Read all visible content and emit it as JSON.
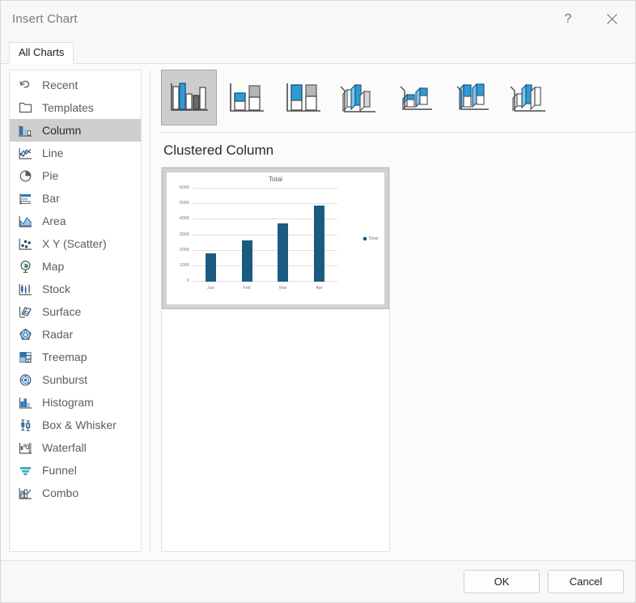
{
  "window": {
    "title": "Insert Chart",
    "help_icon": "question-mark-icon",
    "close_icon": "close-icon"
  },
  "tabs": [
    {
      "label": "All Charts",
      "selected": true
    }
  ],
  "sidebar": {
    "items": [
      {
        "label": "Recent",
        "icon": "recent-icon",
        "selected": false
      },
      {
        "label": "Templates",
        "icon": "templates-icon",
        "selected": false
      },
      {
        "label": "Column",
        "icon": "column-icon",
        "selected": true
      },
      {
        "label": "Line",
        "icon": "line-icon",
        "selected": false
      },
      {
        "label": "Pie",
        "icon": "pie-icon",
        "selected": false
      },
      {
        "label": "Bar",
        "icon": "bar-icon",
        "selected": false
      },
      {
        "label": "Area",
        "icon": "area-icon",
        "selected": false
      },
      {
        "label": "X Y (Scatter)",
        "icon": "scatter-icon",
        "selected": false
      },
      {
        "label": "Map",
        "icon": "map-icon",
        "selected": false
      },
      {
        "label": "Stock",
        "icon": "stock-icon",
        "selected": false
      },
      {
        "label": "Surface",
        "icon": "surface-icon",
        "selected": false
      },
      {
        "label": "Radar",
        "icon": "radar-icon",
        "selected": false
      },
      {
        "label": "Treemap",
        "icon": "treemap-icon",
        "selected": false
      },
      {
        "label": "Sunburst",
        "icon": "sunburst-icon",
        "selected": false
      },
      {
        "label": "Histogram",
        "icon": "histogram-icon",
        "selected": false
      },
      {
        "label": "Box & Whisker",
        "icon": "box-whisker-icon",
        "selected": false
      },
      {
        "label": "Waterfall",
        "icon": "waterfall-icon",
        "selected": false
      },
      {
        "label": "Funnel",
        "icon": "funnel-icon",
        "selected": false
      },
      {
        "label": "Combo",
        "icon": "combo-icon",
        "selected": false
      }
    ]
  },
  "gallery": {
    "thumbnails": [
      {
        "name": "clustered-column",
        "selected": true
      },
      {
        "name": "stacked-column",
        "selected": false
      },
      {
        "name": "100-percent-stacked-column",
        "selected": false
      },
      {
        "name": "3d-clustered-column",
        "selected": false
      },
      {
        "name": "3d-stacked-column",
        "selected": false
      },
      {
        "name": "3d-100-percent-stacked-column",
        "selected": false
      },
      {
        "name": "3d-column",
        "selected": false
      }
    ]
  },
  "preview": {
    "heading": "Clustered Column"
  },
  "footer": {
    "ok_label": "OK",
    "cancel_label": "Cancel"
  },
  "colors": {
    "bar": "#1b5b7f",
    "selection": "#cfcfcf",
    "icon_blue": "#2e75b6",
    "icon_gray": "#595959"
  },
  "chart_data": {
    "type": "bar",
    "title": "Total",
    "categories": [
      "Jan",
      "Feb",
      "Mar",
      "Apr"
    ],
    "series": [
      {
        "name": "Total",
        "values": [
          1850,
          2650,
          3750,
          4900
        ]
      }
    ],
    "xlabel": "",
    "ylabel": "",
    "ylim": [
      0,
      6000
    ],
    "yticks": [
      0,
      1000,
      2000,
      3000,
      4000,
      5000,
      6000
    ],
    "ytick_labels": [
      "0",
      "1000",
      "2000",
      "3000",
      "4000",
      "5000",
      "6000"
    ],
    "grid": true,
    "legend": [
      "Total"
    ],
    "legend_position": "right"
  }
}
